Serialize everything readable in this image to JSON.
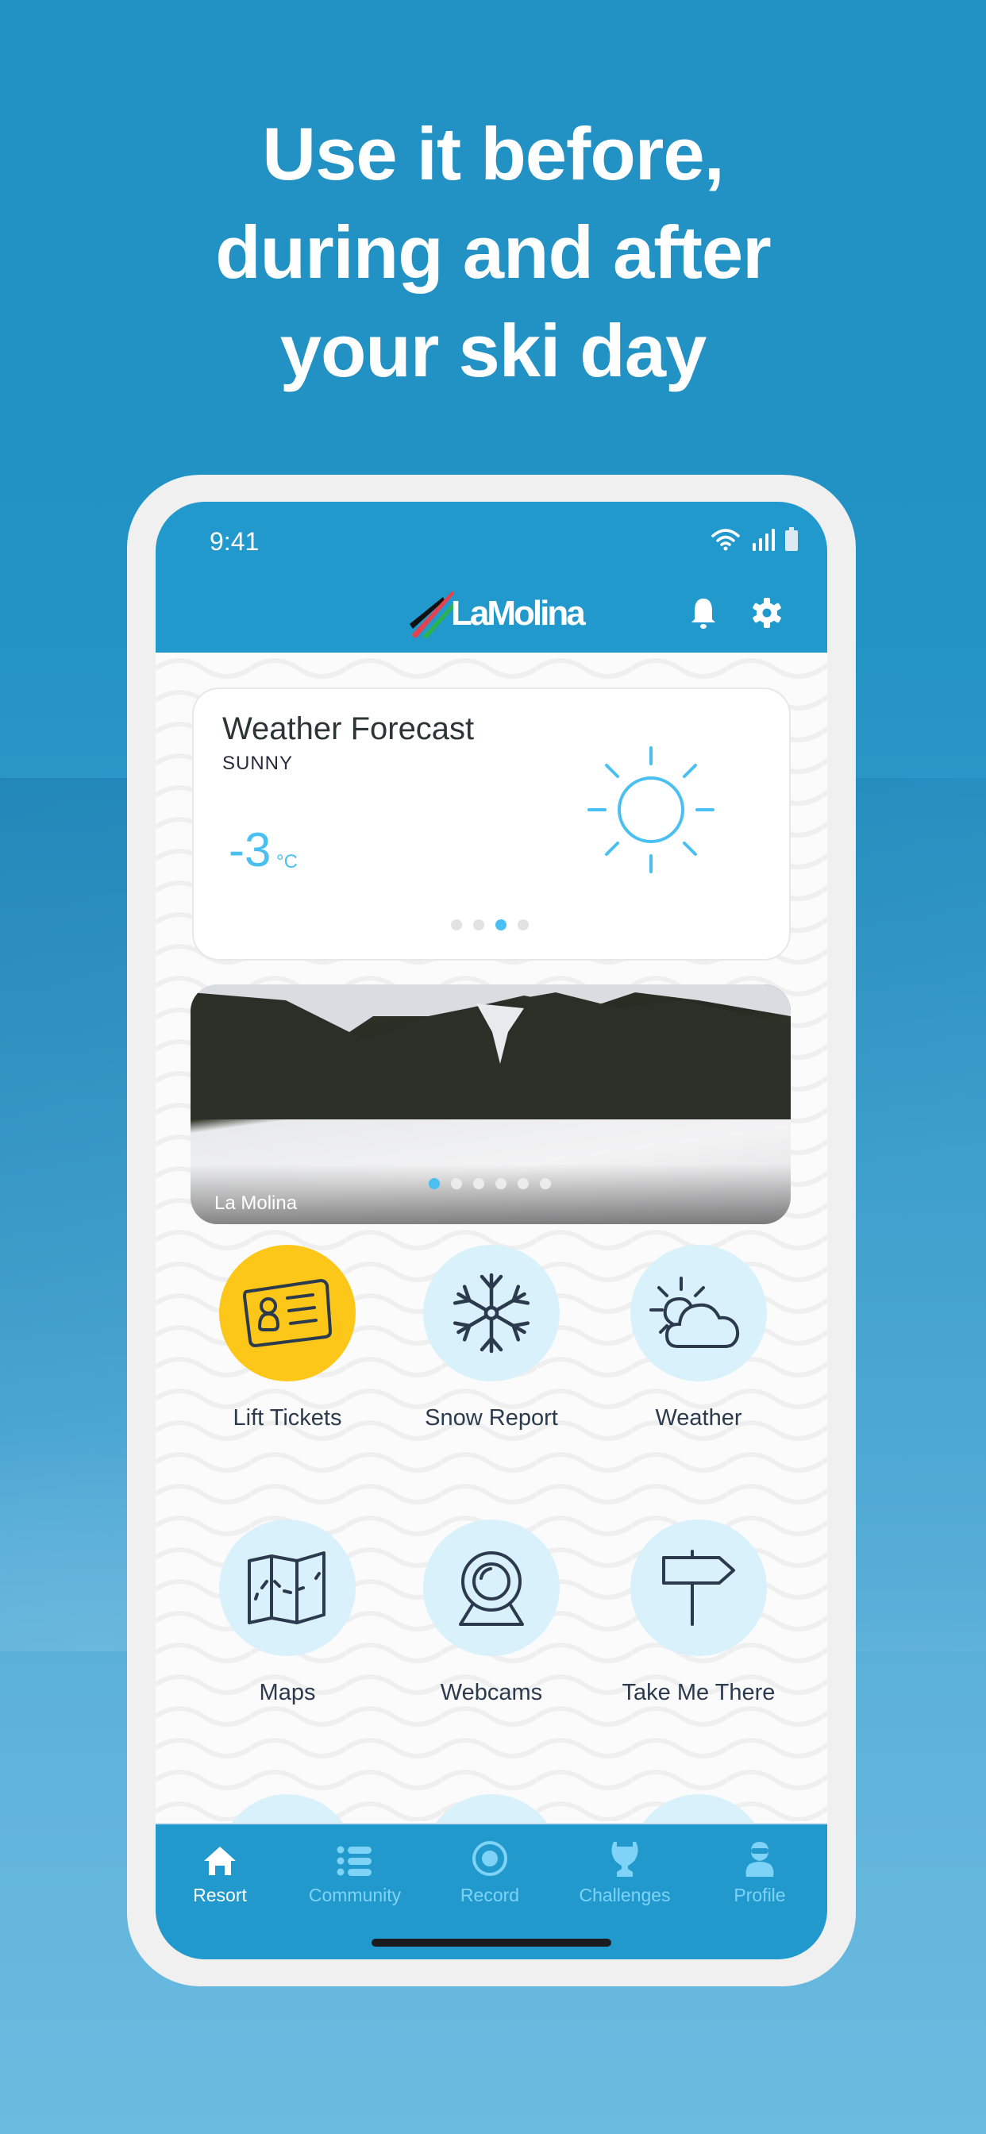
{
  "headline": {
    "lines": [
      "Use it before,",
      "during and after",
      "your ski day"
    ]
  },
  "status_bar": {
    "time": "9:41",
    "icons": [
      "wifi-icon",
      "signal-icon",
      "battery-icon"
    ]
  },
  "app_header": {
    "logo_text": "LaMolina",
    "actions": [
      {
        "name": "notifications",
        "icon": "bell-icon"
      },
      {
        "name": "settings",
        "icon": "gear-icon"
      }
    ]
  },
  "weather_card": {
    "title": "Weather Forecast",
    "condition": "SUNNY",
    "temperature": "-3",
    "unit": "°C",
    "icon": "sun-icon",
    "pager": {
      "count": 4,
      "active_index": 2
    }
  },
  "webcam_card": {
    "caption": "La Molina",
    "pager": {
      "count": 6,
      "active_index": 0
    }
  },
  "tiles": [
    {
      "label": "Lift Tickets",
      "icon": "ticket-card-icon",
      "highlight": true
    },
    {
      "label": "Snow Report",
      "icon": "snowflake-icon",
      "highlight": false
    },
    {
      "label": "Weather",
      "icon": "sun-cloud-icon",
      "highlight": false
    },
    {
      "label": "Maps",
      "icon": "map-icon",
      "highlight": false
    },
    {
      "label": "Webcams",
      "icon": "webcam-icon",
      "highlight": false
    },
    {
      "label": "Take Me There",
      "icon": "signpost-icon",
      "highlight": false
    }
  ],
  "tabbar": {
    "items": [
      {
        "label": "Resort",
        "icon": "home-icon",
        "active": true
      },
      {
        "label": "Community",
        "icon": "list-icon",
        "active": false
      },
      {
        "label": "Record",
        "icon": "record-icon",
        "active": false
      },
      {
        "label": "Challenges",
        "icon": "trophy-icon",
        "active": false
      },
      {
        "label": "Profile",
        "icon": "skier-profile-icon",
        "active": false
      }
    ]
  },
  "colors": {
    "brand_blue": "#2199cd",
    "accent_light_blue": "#4ac0f2",
    "tile_bg": "#d9f1fb",
    "highlight_yellow": "#fcc719",
    "icon_stroke": "#2c3a4e"
  }
}
